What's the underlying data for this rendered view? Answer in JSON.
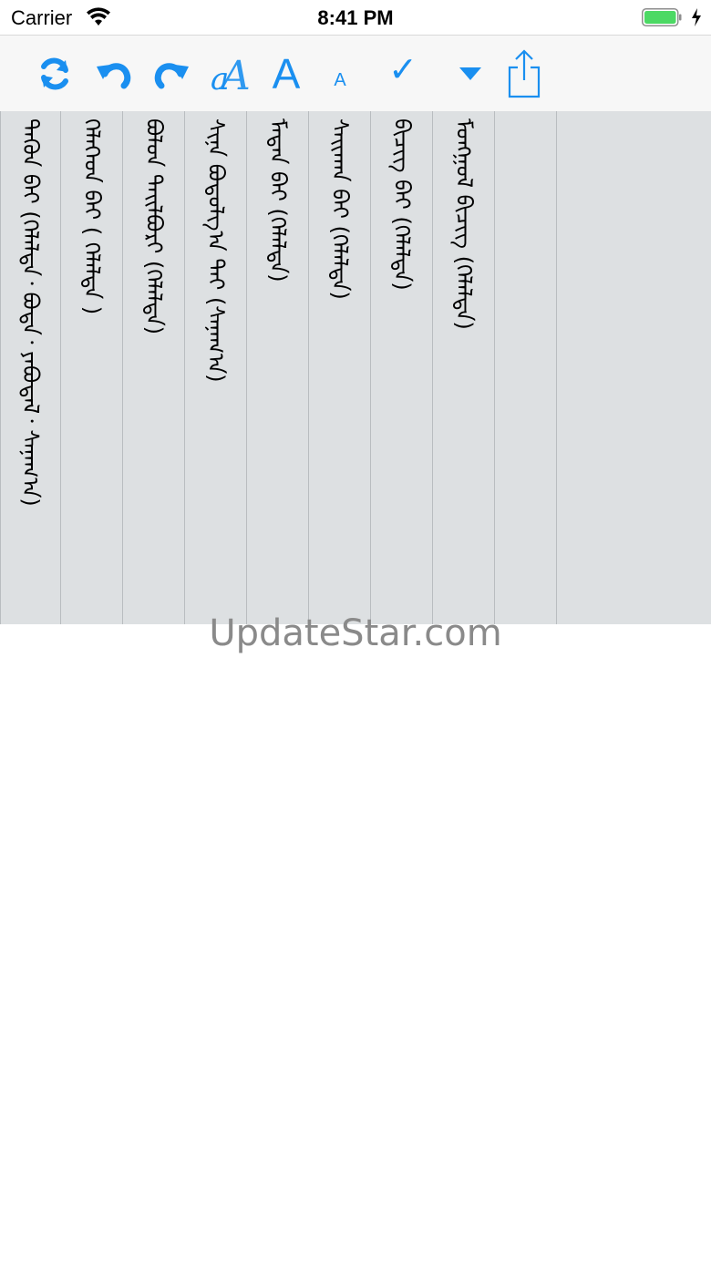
{
  "status_bar": {
    "carrier": "Carrier",
    "time": "8:41 PM",
    "battery_color": "#4cd964"
  },
  "toolbar": {
    "accent_color": "#1a8ff0",
    "tools": [
      {
        "name": "refresh-icon"
      },
      {
        "name": "undo-icon"
      },
      {
        "name": "redo-icon"
      },
      {
        "name": "font-style-icon"
      },
      {
        "name": "font-increase",
        "label": "A"
      },
      {
        "name": "font-decrease",
        "label": "A"
      },
      {
        "name": "checkmark",
        "label": "✓"
      },
      {
        "name": "dropdown-arrow-icon"
      },
      {
        "name": "share-icon"
      }
    ]
  },
  "columns": [
    {
      "text": "ᠲᠡᠭᠦᠨ ᠪᠠᠢ (ᠬᠡᠯᠡᠯᠲᠡ᠂ ᠪᠣᠳᠠ᠂ ᠶᠠᠪᠤᠳᠠᠯ᠂ ᠰᠠᠨᠠᠭ᠎ᠠ)"
    },
    {
      "text": "ᠬᠡᠯᠡᠭᠡᠳ ᠪᠠᠢ ( ᠬᠡᠯᠡᠯᠲᠡ )"
    },
    {
      "text": "ᠪᠣᠯᠤᠨ ᠲᠠᠢᠯᠪᠤᠷᠢ (ᠬᠡᠯᠡᠯᠲᠡ)"
    },
    {
      "text": "ᠰᠢᠨᠡ ᠪᠣᠳᠤᠯᠭ᠎ᠠ ᠲᠠᠢ (ᠰᠠᠨᠠᠭ᠎ᠠ)"
    },
    {
      "text": "ᠮᠡᠳᠡᠨ ᠪᠠᠢ (ᠬᠡᠯᠡᠯᠲᠡ)"
    },
    {
      "text": "ᠰᠠᠢᠬᠠᠨ ᠪᠠᠢ (ᠬᠡᠯᠡᠯᠲᠡ)"
    },
    {
      "text": "ᠪᠢᠴᠢᠭ ᠪᠠᠢ (ᠬᠡᠯᠡᠯᠲᠡ)"
    },
    {
      "text": "ᠮᠣᠩᠭᠣᠯ ᠪᠢᠴᠢᠭ (ᠬᠡᠯᠡᠯᠲᠡ)"
    },
    {
      "text": ""
    }
  ],
  "watermark": "UpdateStar.com"
}
